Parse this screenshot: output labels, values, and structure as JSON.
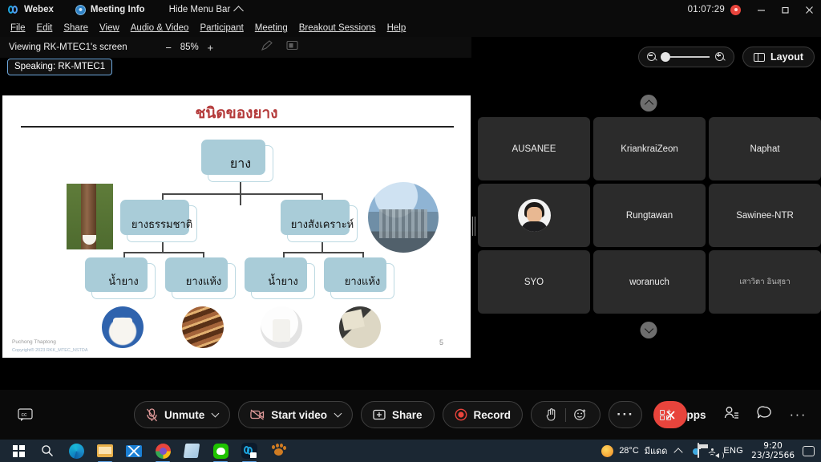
{
  "titlebar": {
    "app_name": "Webex",
    "meeting_info": "Meeting Info",
    "hide_menu_bar": "Hide Menu Bar",
    "recording_timer": "01:07:29",
    "minimize": "–",
    "maximize": "❐",
    "close": "✕"
  },
  "menubar": {
    "items": [
      {
        "label": "File"
      },
      {
        "label": "Edit"
      },
      {
        "label": "Share"
      },
      {
        "label": "View"
      },
      {
        "label": "Audio & Video"
      },
      {
        "label": "Participant"
      },
      {
        "label": "Meeting"
      },
      {
        "label": "Breakout Sessions"
      },
      {
        "label": "Help"
      }
    ]
  },
  "sharebar": {
    "viewing_text": "Viewing RK-MTEC1's screen",
    "zoom_out": "−",
    "zoom_value": "85%",
    "zoom_in": "+",
    "speaking_badge": "Speaking: RK-MTEC1"
  },
  "slide": {
    "title": "ชนิดของยาง",
    "root": "ยาง",
    "level2": [
      "ยางธรรมชาติ",
      "ยางสังเคราะห์"
    ],
    "leaves": [
      "น้ำยาง",
      "ยางแห้ง",
      "น้ำยาง",
      "ยางแห้ง"
    ],
    "author": "Puchong Thaptong",
    "copyright": "Copyright® 2023 RKK_MTEC_NSTDA",
    "page_number": "5"
  },
  "panel": {
    "zoom_slider_value": "",
    "layout_label": "Layout",
    "scroll_up": "scroll-up",
    "scroll_down": "scroll-down",
    "participants": [
      {
        "name": "AUSANEE",
        "has_avatar": false
      },
      {
        "name": "KriankraiZeon",
        "has_avatar": false
      },
      {
        "name": "Naphat",
        "has_avatar": false
      },
      {
        "name": "",
        "has_avatar": true
      },
      {
        "name": "Rungtawan",
        "has_avatar": false
      },
      {
        "name": "Sawinee-NTR",
        "has_avatar": false
      },
      {
        "name": "SYO",
        "has_avatar": false
      },
      {
        "name": "woranuch",
        "has_avatar": false
      },
      {
        "name": "เสาวิตา อินสุธา",
        "has_avatar": false
      }
    ]
  },
  "toolbar": {
    "unmute": "Unmute",
    "start_video": "Start video",
    "share": "Share",
    "record": "Record",
    "more_options": "···",
    "end_call": "✕",
    "apps": "Apps",
    "more": "···"
  },
  "taskbar": {
    "weather_temp": "28°C",
    "weather_desc": "มีแดด",
    "language": "ENG",
    "time": "9:20",
    "date": "23/3/2566"
  },
  "colors": {
    "accent_red": "#e8443c",
    "webex_blue": "#1ea7e1",
    "panel_tile": "#2b2b2b",
    "taskbar_bg": "#1b2733",
    "slide_title_red": "#b43a3a",
    "node_border": "#bcd9e2",
    "node_shadow": "#a9ccd8"
  }
}
